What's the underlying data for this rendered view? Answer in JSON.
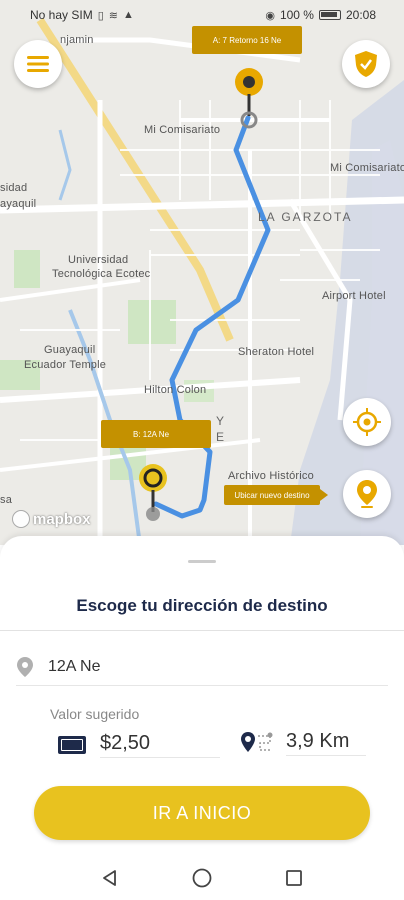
{
  "status_bar": {
    "carrier": "No hay SIM",
    "battery": "100 %",
    "time": "20:08"
  },
  "map": {
    "labels": {
      "mi_comisariato_1": "Mi Comisariato",
      "mi_comisariato_2": "Mi Comisariato",
      "la_garzota": "LA GARZOTA",
      "universidad": "Universidad",
      "tecnologica": "Tecnológica Ecotec",
      "airport_hotel": "Airport Hotel",
      "guayaquil_temple_1": "Guayaquil",
      "guayaquil_temple_2": "Ecuador Temple",
      "sheraton": "Sheraton Hotel",
      "hilton": "Hilton Colon",
      "sidad": "sidad",
      "yaquil": "ayaquil",
      "jamin": "njamin",
      "hotel_cut": "Archivo Histórico",
      "y_letter": "Y",
      "e_letter": "E",
      "sa": "sa"
    },
    "callout_a": "A: 7 Retorno 16 Ne",
    "callout_b": "B: 12A Ne",
    "callout_new": "Ubicar nuevo destino",
    "attribution": "mapbox",
    "accent_color": "#e8c21f",
    "route_color": "#4a90e2"
  },
  "sheet": {
    "title": "Escoge tu dirección de destino",
    "destination": "12A Ne",
    "suggested_label": "Valor sugerido",
    "price": "$2,50",
    "distance": "3,9 Km",
    "go_button": "IR A INICIO"
  }
}
